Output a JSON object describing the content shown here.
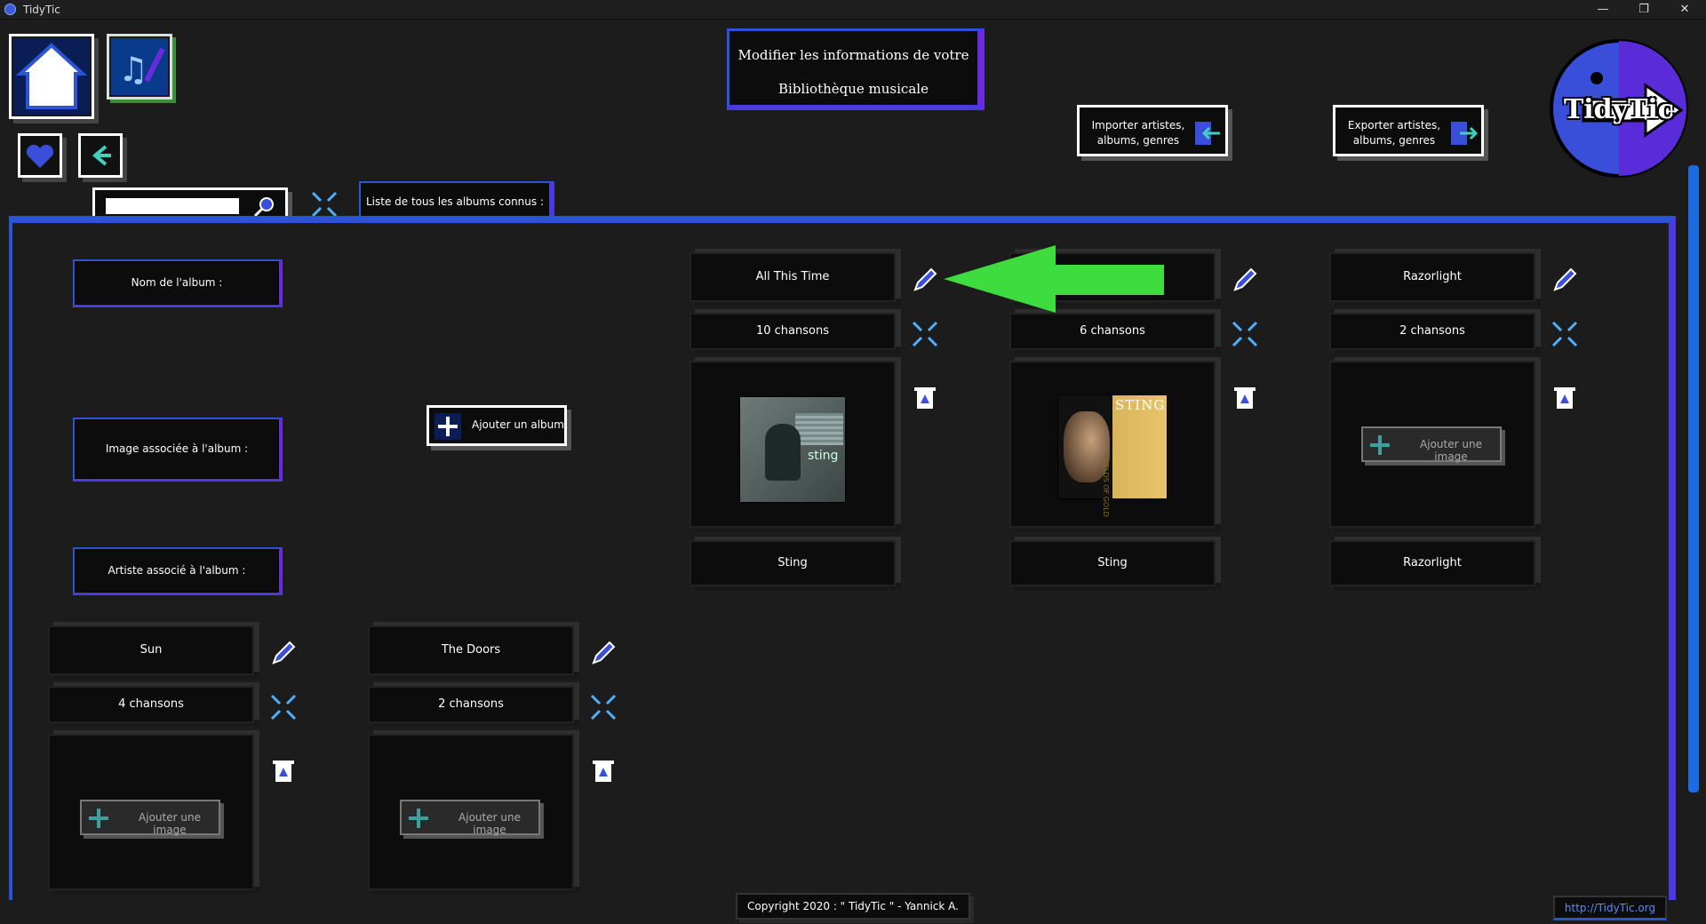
{
  "window": {
    "title": "TidyTic",
    "controls": [
      "—",
      "❐",
      "✕"
    ]
  },
  "header": {
    "title_line1": "Modifier les informations de votre",
    "title_line2": "Bibliothèque musicale",
    "import_label": "Importer artistes, albums, genres",
    "export_label": "Exporter artistes, albums, genres",
    "brand": "TidyTic"
  },
  "search": {
    "placeholder": "",
    "value": ""
  },
  "tab": {
    "label": "Liste de tous les albums connus :"
  },
  "legend": {
    "name_label": "Nom de l'album :",
    "image_label": "Image associée à l'album :",
    "artist_label": "Artiste associé à l'album :"
  },
  "add_album_label": "Ajouter un album",
  "add_image_label": "Ajouter une image",
  "albums": [
    {
      "name": "All This Time",
      "songs": "10 chansons",
      "artist": "Sting",
      "has_image": true
    },
    {
      "name": "",
      "songs": "6 chansons",
      "artist": "Sting",
      "has_image": true
    },
    {
      "name": "Razorlight",
      "songs": "2 chansons",
      "artist": "Razorlight",
      "has_image": false
    },
    {
      "name": "Sun",
      "songs": "4 chansons",
      "artist": "",
      "has_image": false
    },
    {
      "name": "The Doors",
      "songs": "2 chansons",
      "artist": "",
      "has_image": false
    }
  ],
  "album_cover_text": {
    "cover2_title": "STING",
    "cover2_sub": "FIELDS OF GOLD",
    "cover1_sub": "sting"
  },
  "footer": {
    "copyright": "Copyright 2020 : \" TidyTic \" - Yannick A.",
    "link": "http://TidyTic.org"
  },
  "colors": {
    "accent_blue": "#2b55d6",
    "accent_purple": "#6a2be0",
    "arrow_green": "#3fdc3f",
    "link_blue": "#5b8cff"
  }
}
